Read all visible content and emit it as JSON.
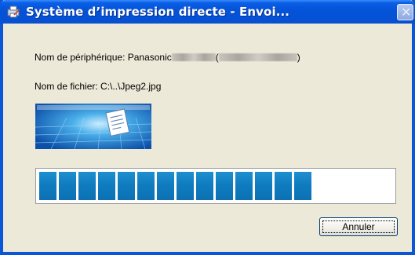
{
  "window": {
    "title": "Système d’impression directe - Envoi..."
  },
  "device": {
    "label": "Nom de périphérique: Panasonic",
    "paren_open": "(",
    "paren_close": ")"
  },
  "file": {
    "label": "Nom de fichier: C:\\..\\Jpeg2.jpg"
  },
  "progress": {
    "filled_blocks": 14,
    "total_blocks": 18,
    "fraction": 0.78,
    "color": "#0f7cc0"
  },
  "buttons": {
    "cancel_label": "Annuler"
  },
  "icons": {
    "title": "printer-app-icon",
    "illustration": "document-transfer-icon",
    "close": "close-icon"
  },
  "colors": {
    "titlebar": "#0553d8",
    "face": "#ece9d8"
  }
}
